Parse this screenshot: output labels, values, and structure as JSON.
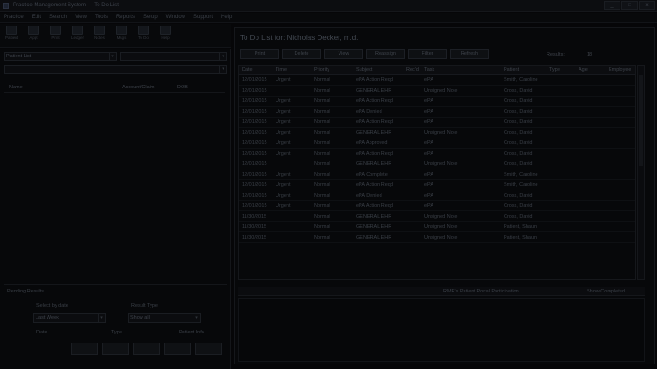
{
  "window": {
    "title": "Practice Management System — To Do List",
    "min": "_",
    "max": "□",
    "close": "x"
  },
  "menu": [
    "Practice",
    "Edit",
    "Search",
    "View",
    "Tools",
    "Reports",
    "Setup",
    "Window",
    "Support",
    "Help"
  ],
  "toolbar": [
    {
      "icon": "patient-icon",
      "label": "Patient"
    },
    {
      "icon": "appointments-icon",
      "label": "Appt"
    },
    {
      "icon": "print-icon",
      "label": "Print"
    },
    {
      "icon": "ledger-icon",
      "label": "Ledger"
    },
    {
      "icon": "notes-icon",
      "label": "Notes"
    },
    {
      "icon": "messages-icon",
      "label": "Msgs"
    },
    {
      "icon": "todo-icon",
      "label": "To Do"
    },
    {
      "icon": "help-icon",
      "label": "Help"
    }
  ],
  "left": {
    "list_combo": "Patient List",
    "filter_combo": "",
    "search_combo": "",
    "headers": {
      "name": "Name",
      "account": "Account/Claim",
      "dob": "DOB"
    },
    "pending": {
      "title": "Pending Results",
      "select_by_label": "Select by date",
      "select_by_value": "Last Week",
      "result_type_label": "Result Type",
      "result_type_value": "Show all",
      "col1": "Date",
      "col2": "Type",
      "col3": "Patient Info"
    }
  },
  "todo": {
    "title": "To Do List for: Nicholas Decker, m.d.",
    "buttons": [
      "Print",
      "Delete",
      "View",
      "Reassign",
      "Filter",
      "Refresh"
    ],
    "results_label": "Results:",
    "results_count": "18",
    "columns": [
      "Date",
      "Time",
      "Priority",
      "Subject",
      "Rec'd",
      "Task",
      "Patient",
      "Type",
      "Age",
      "Employee"
    ],
    "rows": [
      [
        "12/01/2015",
        "Urgent",
        "Normal",
        "ePA Action Reqd",
        "ePA",
        "Smith, Caroline"
      ],
      [
        "12/01/2015",
        "",
        "Normal",
        "GENERAL EHR",
        "Unsigned Note",
        "Cross, David"
      ],
      [
        "12/01/2015",
        "Urgent",
        "Normal",
        "ePA Action Reqd",
        "ePA",
        "Cross, David"
      ],
      [
        "12/01/2015",
        "Urgent",
        "Normal",
        "ePA Denied",
        "ePA",
        "Cross, David"
      ],
      [
        "12/01/2015",
        "Urgent",
        "Normal",
        "ePA Action Reqd",
        "ePA",
        "Cross, David"
      ],
      [
        "12/01/2015",
        "Urgent",
        "Normal",
        "GENERAL EHR",
        "Unsigned Note",
        "Cross, David"
      ],
      [
        "12/01/2015",
        "Urgent",
        "Normal",
        "ePA Approved",
        "ePA",
        "Cross, David"
      ],
      [
        "12/01/2015",
        "Urgent",
        "Normal",
        "ePA Action Reqd",
        "ePA",
        "Cross, David"
      ],
      [
        "12/01/2015",
        "",
        "Normal",
        "GENERAL EHR",
        "Unsigned Note",
        "Cross, David"
      ],
      [
        "12/01/2015",
        "Urgent",
        "Normal",
        "ePA Complete",
        "ePA",
        "Smith, Caroline"
      ],
      [
        "12/01/2015",
        "Urgent",
        "Normal",
        "ePA Action Reqd",
        "ePA",
        "Smith, Caroline"
      ],
      [
        "12/01/2015",
        "Urgent",
        "Normal",
        "ePA Denied",
        "ePA",
        "Cross, David"
      ],
      [
        "12/01/2015",
        "Urgent",
        "Normal",
        "ePA Action Reqd",
        "ePA",
        "Cross, David"
      ],
      [
        "11/30/2015",
        "",
        "Normal",
        "GENERAL EHR",
        "Unsigned Note",
        "Cross, David"
      ],
      [
        "11/30/2015",
        "",
        "Normal",
        "GENERAL EHR",
        "Unsigned Note",
        "Patient, Shaun"
      ],
      [
        "11/30/2015",
        "",
        "Normal",
        "GENERAL EHR",
        "Unsigned Note",
        "Patient, Shaun"
      ]
    ],
    "detail_center": "RMR's Patient Portal Participation",
    "detail_right": "Show Completed"
  }
}
